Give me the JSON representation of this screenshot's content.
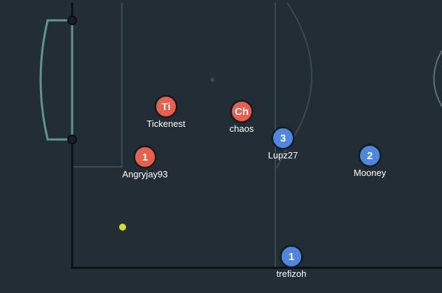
{
  "colors": {
    "background": "#232d36",
    "field_line": "#3a4a55",
    "goal_line": "#5e9690",
    "boundary": "#0b0f12",
    "red_team": "#e8604c",
    "blue_team": "#4f87e0",
    "ball": "#d6df23"
  },
  "players": [
    {
      "team": "red",
      "badge": "Ti",
      "name": "Tickenest"
    },
    {
      "team": "red",
      "badge": "Ch",
      "name": "chaos"
    },
    {
      "team": "red",
      "badge": "1",
      "name": "Angryjay93"
    },
    {
      "team": "blue",
      "badge": "3",
      "name": "Lupz27"
    },
    {
      "team": "blue",
      "badge": "2",
      "name": "Mooney"
    },
    {
      "team": "blue",
      "badge": "1",
      "name": "trefizoh"
    }
  ]
}
